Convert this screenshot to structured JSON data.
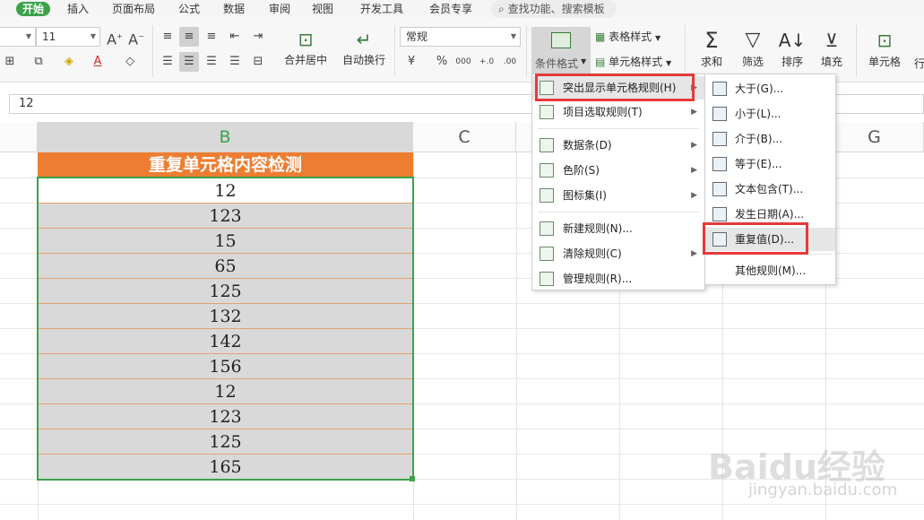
{
  "menubar": {
    "tabs": [
      "开始",
      "插入",
      "页面布局",
      "公式",
      "数据",
      "审阅",
      "视图",
      "开发工具",
      "会员专享"
    ],
    "search_label": "查找功能、搜索模板"
  },
  "ribbon": {
    "font_size": "11",
    "merge_center": "合并居中",
    "wrap_text": "自动换行",
    "number_format": "常规",
    "conditional_format": "条件格式",
    "table_style": "表格样式",
    "cell_style": "单元格样式",
    "sum": "求和",
    "filter": "筛选",
    "sort": "排序",
    "fill": "填充",
    "cell": "单元格",
    "row": "行",
    "currency": "¥",
    "percent": "%",
    "thousands": "000",
    "inc_dec": "+.0",
    "dec_dec": ".00"
  },
  "formula": {
    "value": "12"
  },
  "columns": {
    "B": "B",
    "C": "C",
    "G": "G"
  },
  "sheet": {
    "title": "重复单元格内容检测",
    "values": [
      "12",
      "123",
      "15",
      "65",
      "125",
      "132",
      "142",
      "156",
      "12",
      "123",
      "125",
      "165"
    ]
  },
  "menu": {
    "items": [
      "突出显示单元格规则(H)",
      "项目选取规则(T)",
      "数据条(D)",
      "色阶(S)",
      "图标集(I)",
      "新建规则(N)...",
      "清除规则(C)",
      "管理规则(R)..."
    ]
  },
  "submenu": {
    "items": [
      "大于(G)...",
      "小于(L)...",
      "介于(B)...",
      "等于(E)...",
      "文本包含(T)...",
      "发生日期(A)...",
      "重复值(D)...",
      "其他规则(M)..."
    ]
  },
  "watermark": {
    "brand": "Baidu经验",
    "url": "jingyan.baidu.com"
  },
  "colors": {
    "accent": "#3aa34a",
    "header": "#ed7d31",
    "highlight": "#e53a3a"
  }
}
